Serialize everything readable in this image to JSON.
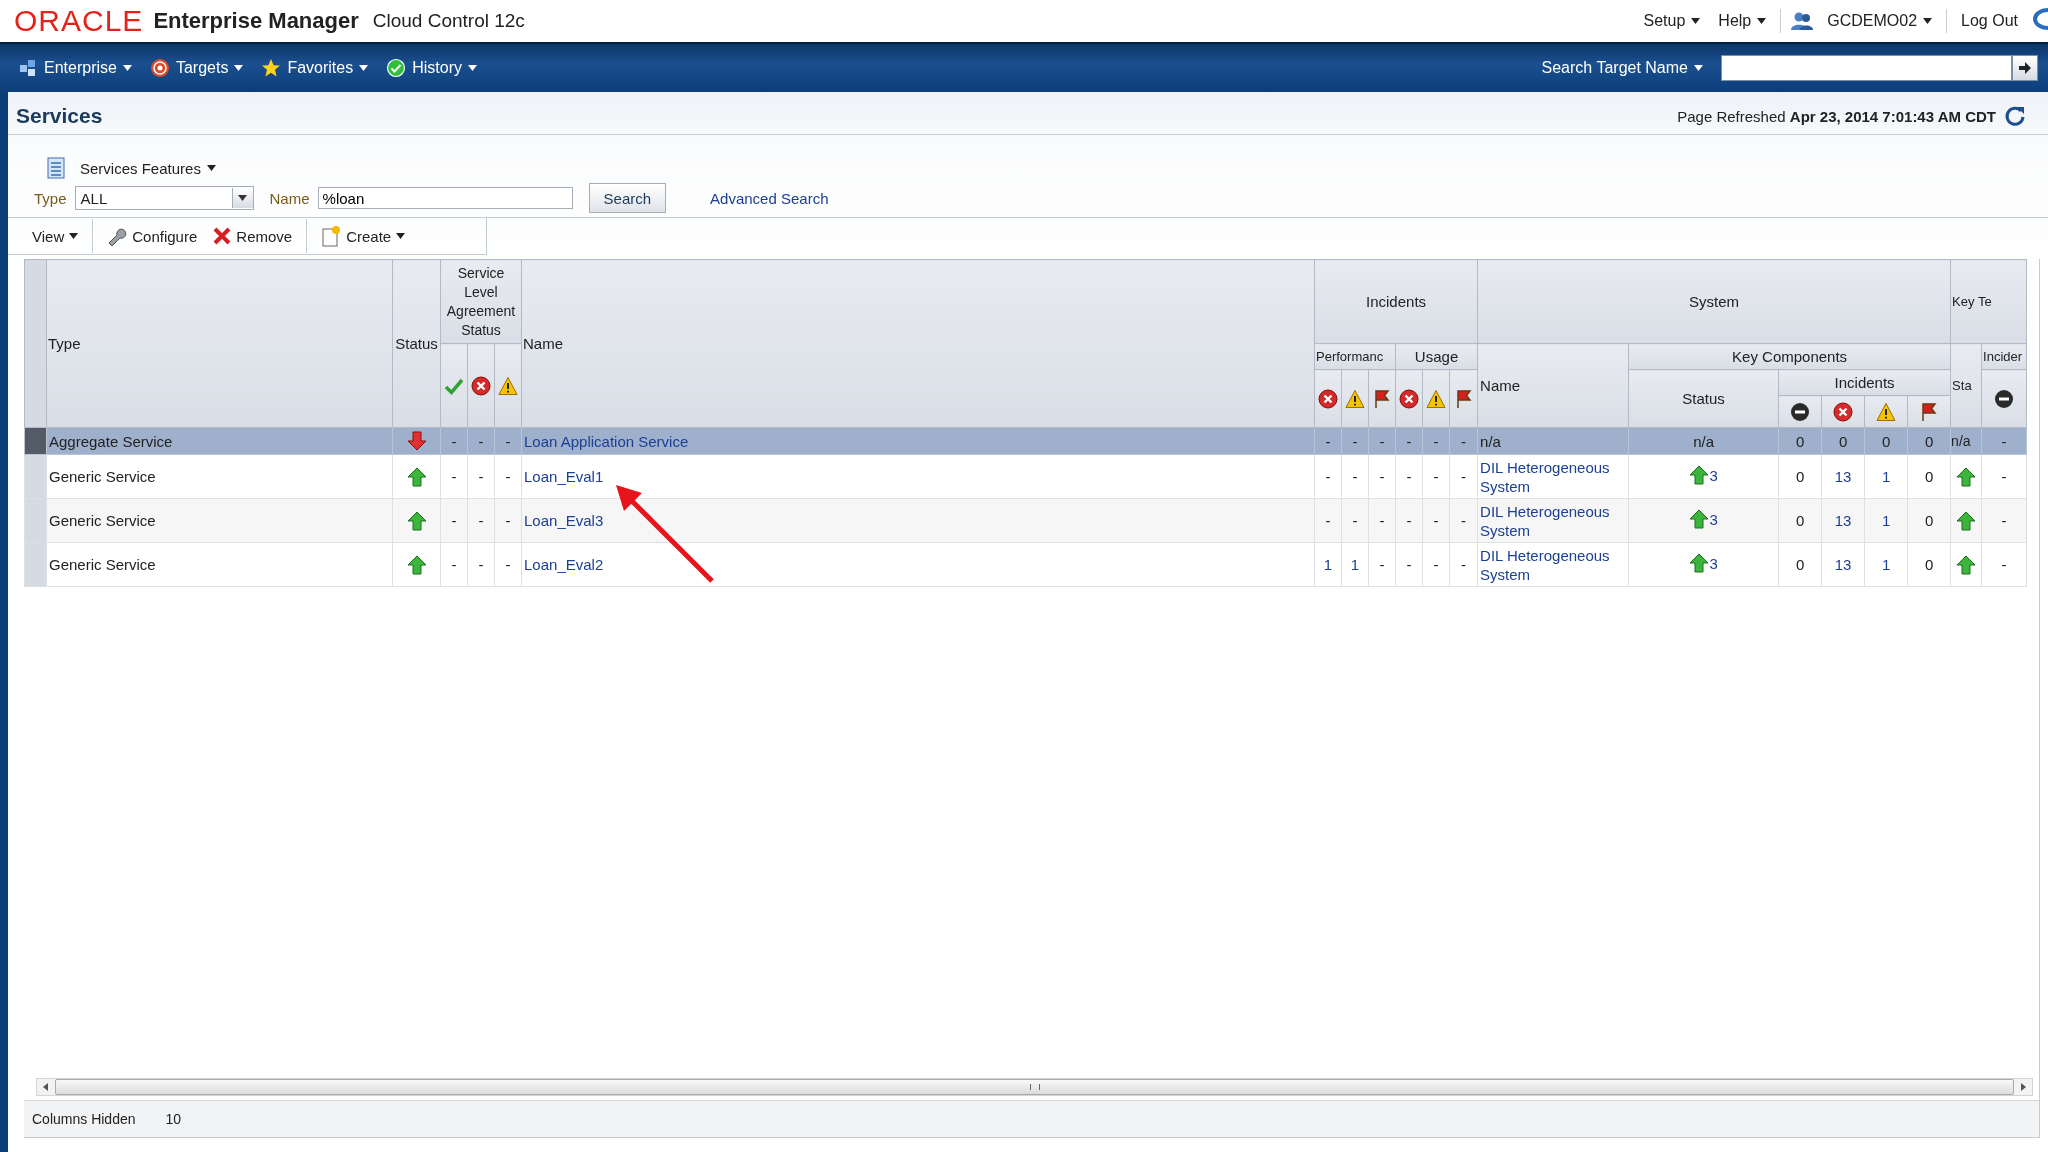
{
  "header": {
    "logo": "ORACLE",
    "product": "Enterprise Manager",
    "edition": "Cloud Control 12c",
    "links": [
      {
        "label": "Setup"
      },
      {
        "label": "Help"
      }
    ],
    "user": "GCDEMO02",
    "logout": "Log Out"
  },
  "nav": {
    "menus": [
      {
        "label": "Enterprise"
      },
      {
        "label": "Targets"
      },
      {
        "label": "Favorites"
      },
      {
        "label": "History"
      }
    ],
    "search_label": "Search Target Name"
  },
  "page": {
    "title": "Services",
    "refreshed_label": "Page Refreshed",
    "refreshed_time": "Apr 23, 2014 7:01:43 AM CDT"
  },
  "features_menu": "Services Features",
  "filter": {
    "type_label": "Type",
    "type_value": "ALL",
    "name_label": "Name",
    "name_value": "%loan",
    "search_button": "Search",
    "advanced_link": "Advanced Search"
  },
  "toolbar": [
    [
      {
        "label": "View",
        "kind": "menu"
      }
    ],
    [
      {
        "label": "Configure",
        "kind": "configure"
      },
      {
        "label": "Remove",
        "kind": "remove"
      }
    ],
    [
      {
        "label": "Create",
        "kind": "create"
      }
    ]
  ],
  "table": {
    "headers": {
      "type": "Type",
      "status": "Status",
      "sla": "Service Level Agreement Status",
      "name": "Name",
      "incidents": "Incidents",
      "performance": "Performanc",
      "usage": "Usage",
      "system": "System",
      "system_name": "Name",
      "key_components": "Key Components",
      "kc_status": "Status",
      "kc_incidents": "Incidents",
      "key_tests": "Key Te",
      "key_tests_status": "Sta",
      "key_tests_incidents": "Incider"
    },
    "rows": [
      {
        "selected": true,
        "type": "Aggregate Service",
        "up": false,
        "sla": [
          "-",
          "-",
          "-"
        ],
        "name": "Loan Application Service",
        "incidents": [
          "-",
          "-",
          "-",
          "-",
          "-",
          "-"
        ],
        "system": {
          "kind": "text",
          "name": "n/a"
        },
        "kc_status": {
          "kind": "text",
          "text": "n/a"
        },
        "kc_incidents": [
          "0",
          "0",
          "0",
          "0"
        ],
        "key_tests_status": {
          "kind": "text",
          "text": "n/a"
        },
        "key_tests_incidents": "-"
      },
      {
        "selected": false,
        "type": "Generic Service",
        "up": true,
        "sla": [
          "-",
          "-",
          "-"
        ],
        "name": "Loan_Eval1",
        "incidents": [
          "-",
          "-",
          "-",
          "-",
          "-",
          "-"
        ],
        "system": {
          "kind": "link",
          "name": "DIL Heterogeneous System"
        },
        "kc_status": {
          "kind": "icon",
          "up": true,
          "count": "3"
        },
        "kc_incidents": [
          "0",
          {
            "text": "13",
            "link": true
          },
          {
            "text": "1",
            "link": true
          },
          "0"
        ],
        "key_tests_status": {
          "kind": "icon",
          "up": true
        },
        "key_tests_incidents": "-"
      },
      {
        "selected": false,
        "type": "Generic Service",
        "up": true,
        "sla": [
          "-",
          "-",
          "-"
        ],
        "name": "Loan_Eval3",
        "incidents": [
          "-",
          "-",
          "-",
          "-",
          "-",
          "-"
        ],
        "system": {
          "kind": "link",
          "name": "DIL Heterogeneous System"
        },
        "kc_status": {
          "kind": "icon",
          "up": true,
          "count": "3"
        },
        "kc_incidents": [
          "0",
          {
            "text": "13",
            "link": true
          },
          {
            "text": "1",
            "link": true
          },
          "0"
        ],
        "key_tests_status": {
          "kind": "icon",
          "up": true
        },
        "key_tests_incidents": "-"
      },
      {
        "selected": false,
        "type": "Generic Service",
        "up": true,
        "sla": [
          "-",
          "-",
          "-"
        ],
        "name": "Loan_Eval2",
        "incidents": [
          {
            "text": "1",
            "link": true
          },
          {
            "text": "1",
            "link": true
          },
          "-",
          "-",
          "-",
          "-"
        ],
        "system": {
          "kind": "link",
          "name": "DIL Heterogeneous System"
        },
        "kc_status": {
          "kind": "icon",
          "up": true,
          "count": "3"
        },
        "kc_incidents": [
          "0",
          {
            "text": "13",
            "link": true
          },
          {
            "text": "1",
            "link": true
          },
          "0"
        ],
        "key_tests_status": {
          "kind": "icon",
          "up": true
        },
        "key_tests_incidents": "-"
      }
    ]
  },
  "status_bar": {
    "label": "Columns Hidden",
    "value": "10"
  }
}
